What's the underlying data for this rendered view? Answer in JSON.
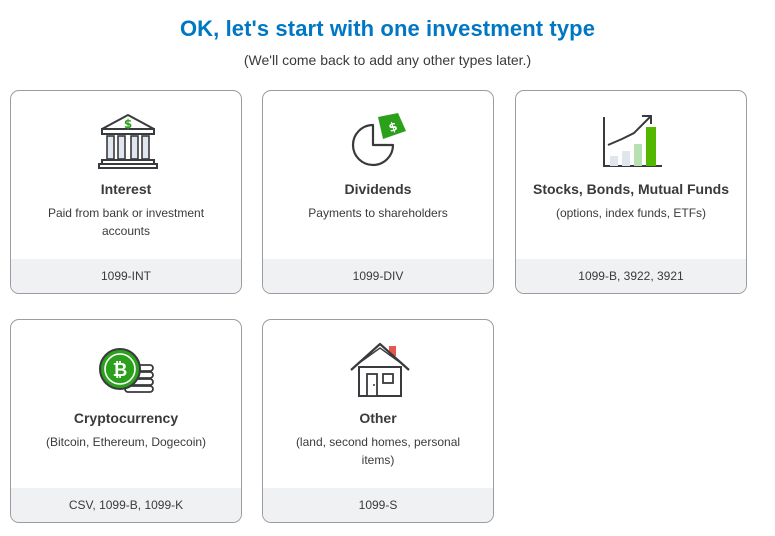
{
  "header": {
    "title": "OK, let's start with one investment type",
    "subtitle": "(We'll come back to add any other types later.)"
  },
  "cards": [
    {
      "icon": "bank-icon",
      "name": "Interest",
      "description": "Paid from bank or investment accounts",
      "forms": "1099-INT"
    },
    {
      "icon": "pie-chart-dollar-icon",
      "name": "Dividends",
      "description": "Payments to shareholders",
      "forms": "1099-DIV"
    },
    {
      "icon": "growth-chart-icon",
      "name": "Stocks, Bonds, Mutual Funds",
      "description": "(options, index funds, ETFs)",
      "forms": "1099-B, 3922, 3921"
    },
    {
      "icon": "bitcoin-coins-icon",
      "name": "Cryptocurrency",
      "description": "(Bitcoin, Ethereum, Dogecoin)",
      "forms": "CSV, 1099-B, 1099-K"
    },
    {
      "icon": "house-icon",
      "name": "Other",
      "description": "(land, second homes, personal items)",
      "forms": "1099-S"
    }
  ],
  "colors": {
    "title": "#0077c5",
    "accent_green": "#2ca01c",
    "icon_stroke": "#393a3d",
    "footer_bg": "#eff1f2",
    "card_border": "#9a9ca0"
  }
}
